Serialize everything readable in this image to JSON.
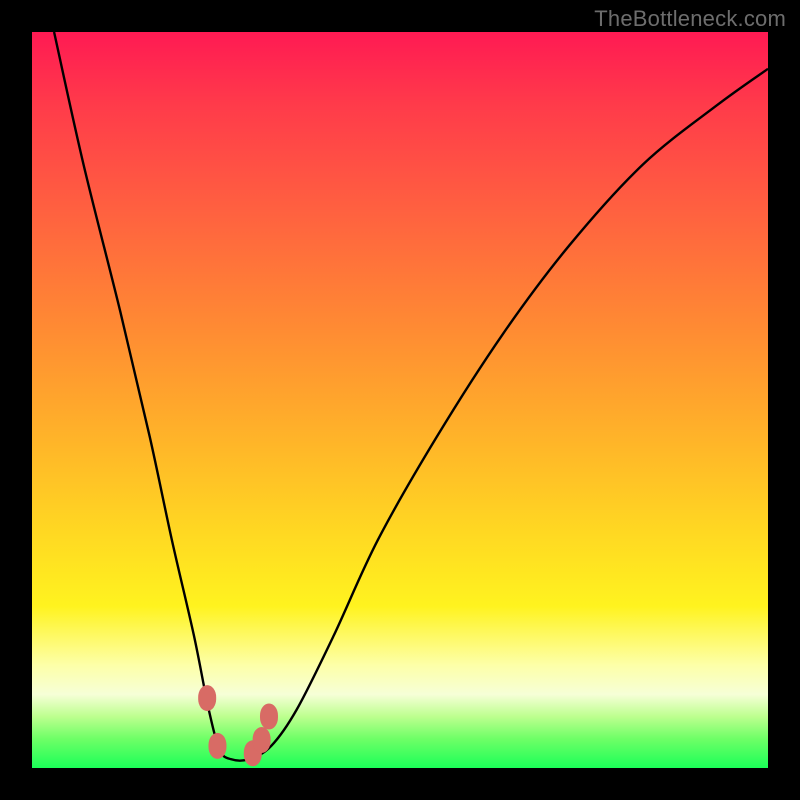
{
  "watermark": "TheBottleneck.com",
  "chart_data": {
    "type": "line",
    "title": "",
    "xlabel": "",
    "ylabel": "",
    "xlim": [
      0,
      100
    ],
    "ylim": [
      0,
      100
    ],
    "series": [
      {
        "name": "bottleneck-curve",
        "x": [
          3,
          7,
          12,
          16,
          19,
          22,
          24,
          25.5,
          27,
          29.5,
          32.5,
          36,
          41,
          47,
          55,
          64,
          73,
          83,
          93,
          100
        ],
        "values": [
          100,
          82,
          62,
          45,
          31,
          18,
          8,
          2.5,
          1.2,
          1.2,
          3,
          8,
          18,
          31,
          45,
          59,
          71,
          82,
          90,
          95
        ]
      }
    ],
    "annotations": [
      {
        "name": "marker-left-upper",
        "x": 23.8,
        "y": 9.5
      },
      {
        "name": "marker-left-lower",
        "x": 25.2,
        "y": 3.0
      },
      {
        "name": "marker-right-lower",
        "x": 30.0,
        "y": 2.0
      },
      {
        "name": "marker-right-upper",
        "x": 32.2,
        "y": 7.0
      },
      {
        "name": "marker-right-extra",
        "x": 31.2,
        "y": 3.8
      }
    ],
    "colors": {
      "curve_stroke": "#000000",
      "marker_fill": "#d86b65",
      "gradient_top": "#ff1a53",
      "gradient_bottom": "#1bff58"
    }
  }
}
